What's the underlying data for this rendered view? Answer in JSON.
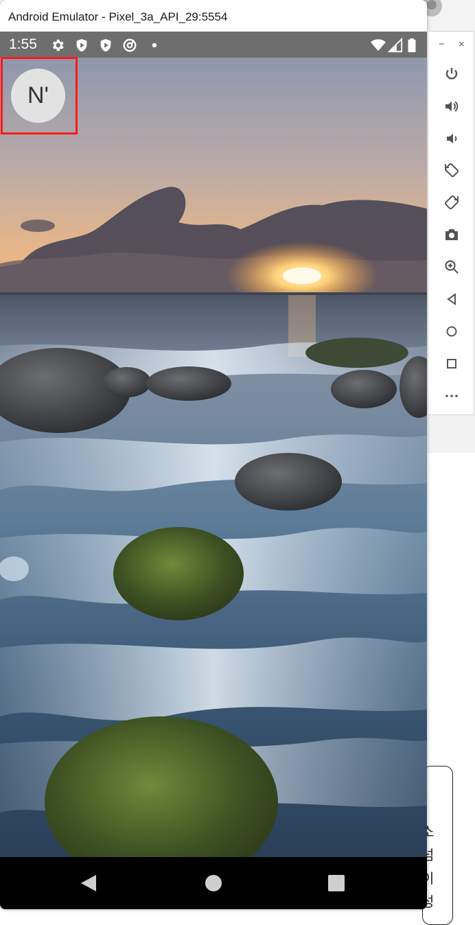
{
  "window": {
    "title": "Android Emulator - Pixel_3a_API_29:5554"
  },
  "status_bar": {
    "time": "1:55",
    "icons": [
      "settings-icon",
      "shield-icon",
      "play-protect-icon",
      "at-sign-icon",
      "notification-dot-icon",
      "wifi-icon",
      "signal-icon",
      "battery-icon"
    ]
  },
  "home": {
    "avatar_text": "N'"
  },
  "navigation": {
    "buttons": [
      "back-icon",
      "home-icon",
      "recents-icon"
    ]
  },
  "toolbar": {
    "minimize": "−",
    "close": "×",
    "buttons": [
      "power-icon",
      "volume-up-icon",
      "volume-down-icon",
      "rotate-left-icon",
      "rotate-right-icon",
      "camera-icon",
      "zoom-icon",
      "back-icon",
      "home-icon",
      "overview-icon",
      "more-icon"
    ]
  },
  "background_app": {
    "glyphs": [
      "소",
      "넘",
      "이",
      "성"
    ]
  },
  "colors": {
    "accent_highlight": "#ff1a1a",
    "status_bar": "#6e6e6e",
    "nav_bar": "#000000"
  }
}
